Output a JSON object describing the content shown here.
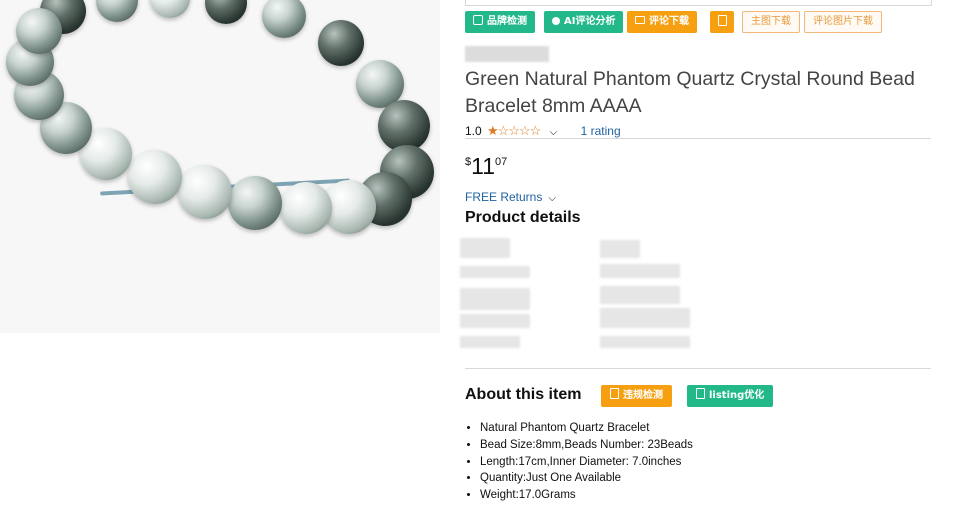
{
  "toolbar": {
    "brand_check": "品牌检测",
    "ai_review": "AI评论分析",
    "review_download": "评论下载",
    "main_image_download": "主图下载",
    "review_image_download": "评论图片下载"
  },
  "product": {
    "title": "Green Natural Phantom Quartz Crystal Round Bead Bracelet 8mm AAAA",
    "rating_value": "1.0",
    "stars": "★☆☆☆☆",
    "rating_count": "1 rating",
    "price_symbol": "$",
    "price_whole": "11",
    "price_fraction": "07",
    "returns": "FREE Returns"
  },
  "details": {
    "heading": "Product details"
  },
  "about": {
    "heading": "About this item",
    "violation_check": "违规检测",
    "listing_optimize": "listing优化",
    "bullets": [
      "Natural Phantom Quartz Bracelet",
      "Bead Size:8mm,Beads Number: 23Beads",
      "Length:17cm,Inner Diameter: 7.0inches",
      "Quantity:Just One Available",
      "Weight:17.0Grams"
    ]
  },
  "icons": {
    "star_color": "#de7921",
    "green": "#23b88a",
    "orange": "#f6a011"
  }
}
